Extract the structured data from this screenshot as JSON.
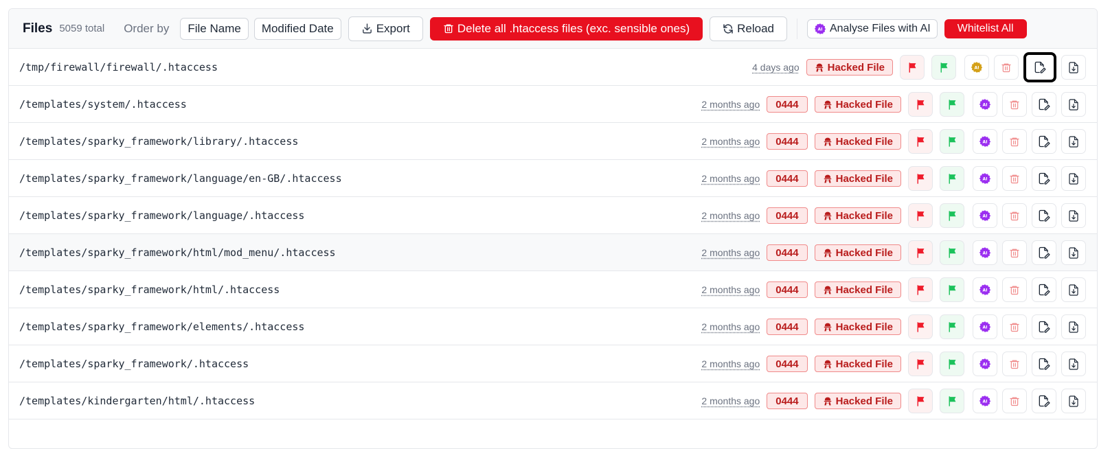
{
  "header": {
    "title": "Files",
    "total": "5059 total",
    "order_by": "Order by",
    "sort_name": "File Name",
    "sort_date": "Modified Date",
    "export": "Export",
    "delete_all": "Delete all .htaccess files (exc. sensible ones)",
    "reload": "Reload",
    "analyse": "Analyse Files with AI",
    "whitelist": "Whitelist All"
  },
  "labels": {
    "hacked": "Hacked File"
  },
  "colors": {
    "danger": "#e8101f",
    "flag_red": "#ef1c2b",
    "flag_green": "#1cc25c",
    "ai_purple": "#9b2ff0",
    "ai_gold": "#d4a017",
    "trash": "#f08a8a"
  },
  "icons": {
    "export": "export-icon",
    "trash": "trash-icon",
    "reload": "reload-icon",
    "ai": "ai-chip-icon",
    "hacked": "hacked-icon",
    "flag": "flag-icon",
    "edit": "file-edit-icon",
    "download": "file-download-icon"
  },
  "files": [
    {
      "path": "/tmp/firewall/firewall/.htaccess",
      "modified": "4 days ago",
      "perm": "",
      "ai_state": "pending",
      "focused_edit": true
    },
    {
      "path": "/templates/system/.htaccess",
      "modified": "2 months ago",
      "perm": "0444",
      "ai_state": "done"
    },
    {
      "path": "/templates/sparky_framework/library/.htaccess",
      "modified": "2 months ago",
      "perm": "0444",
      "ai_state": "done"
    },
    {
      "path": "/templates/sparky_framework/language/en-GB/.htaccess",
      "modified": "2 months ago",
      "perm": "0444",
      "ai_state": "done"
    },
    {
      "path": "/templates/sparky_framework/language/.htaccess",
      "modified": "2 months ago",
      "perm": "0444",
      "ai_state": "done"
    },
    {
      "path": "/templates/sparky_framework/html/mod_menu/.htaccess",
      "modified": "2 months ago",
      "perm": "0444",
      "ai_state": "done",
      "hover": true
    },
    {
      "path": "/templates/sparky_framework/html/.htaccess",
      "modified": "2 months ago",
      "perm": "0444",
      "ai_state": "done"
    },
    {
      "path": "/templates/sparky_framework/elements/.htaccess",
      "modified": "2 months ago",
      "perm": "0444",
      "ai_state": "done"
    },
    {
      "path": "/templates/sparky_framework/.htaccess",
      "modified": "2 months ago",
      "perm": "0444",
      "ai_state": "done"
    },
    {
      "path": "/templates/kindergarten/html/.htaccess",
      "modified": "2 months ago",
      "perm": "0444",
      "ai_state": "done"
    }
  ]
}
